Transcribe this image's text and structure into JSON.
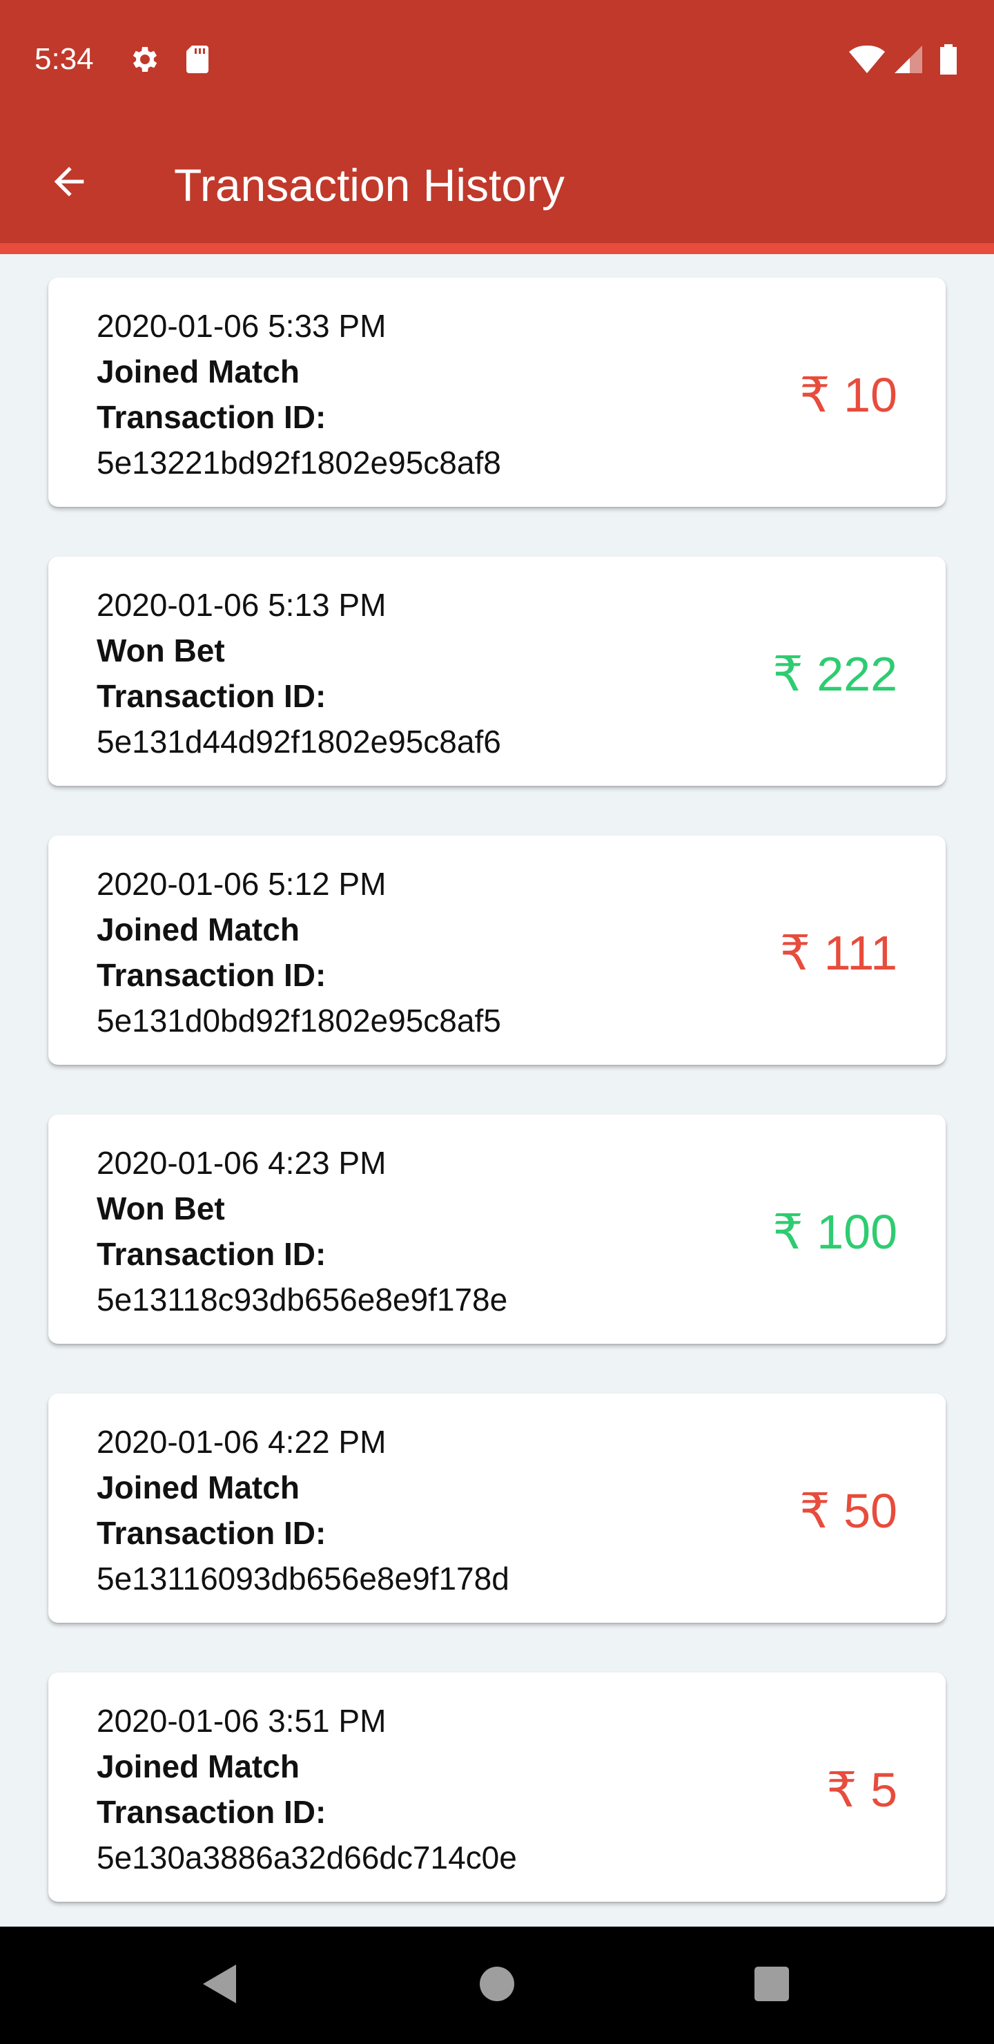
{
  "status_bar": {
    "time": "5:34",
    "icons": [
      "settings-icon",
      "sd-card-icon",
      "wifi-icon",
      "cellular-signal-icon",
      "battery-icon"
    ]
  },
  "app_bar": {
    "back_icon": "arrow-back-icon",
    "title": "Transaction History"
  },
  "colors": {
    "primary": "#c0392b",
    "accent": "#e74c3c",
    "debit": "#e74c3c",
    "credit": "#2ecc71",
    "background": "#eef3f6"
  },
  "transactions": [
    {
      "date": "2020-01-06 5:33 PM",
      "type": "Joined Match",
      "id_label": "Transaction ID:",
      "id": "5e13221bd92f1802e95c8af8",
      "amount": "₹ 10",
      "direction": "debit"
    },
    {
      "date": "2020-01-06 5:13 PM",
      "type": "Won Bet",
      "id_label": "Transaction ID:",
      "id": "5e131d44d92f1802e95c8af6",
      "amount": "₹ 222",
      "direction": "credit"
    },
    {
      "date": "2020-01-06 5:12 PM",
      "type": "Joined Match",
      "id_label": "Transaction ID:",
      "id": "5e131d0bd92f1802e95c8af5",
      "amount": "₹ 111",
      "direction": "debit"
    },
    {
      "date": "2020-01-06 4:23 PM",
      "type": "Won Bet",
      "id_label": "Transaction ID:",
      "id": "5e13118c93db656e8e9f178e",
      "amount": "₹ 100",
      "direction": "credit"
    },
    {
      "date": "2020-01-06 4:22 PM",
      "type": "Joined Match",
      "id_label": "Transaction ID:",
      "id": "5e13116093db656e8e9f178d",
      "amount": "₹ 50",
      "direction": "debit"
    },
    {
      "date": "2020-01-06 3:51 PM",
      "type": "Joined Match",
      "id_label": "Transaction ID:",
      "id": "5e130a3886a32d66dc714c0e",
      "amount": "₹ 5",
      "direction": "debit"
    }
  ],
  "nav_bar": {
    "icons": [
      "nav-back-icon",
      "nav-home-icon",
      "nav-recents-icon"
    ]
  }
}
